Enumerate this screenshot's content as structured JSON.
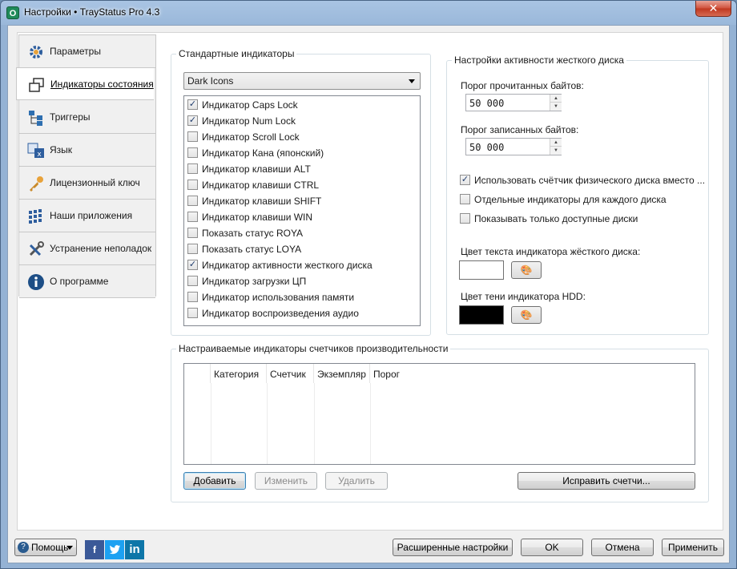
{
  "window": {
    "title": "Настройки • TrayStatus Pro 4.3",
    "app_icon_glyph": "O",
    "close_glyph": "✕"
  },
  "sidebar": {
    "items": [
      {
        "label": "Параметры",
        "icon": "gear-icon"
      },
      {
        "label": "Индикаторы состояния",
        "icon": "windows-icon",
        "active": true
      },
      {
        "label": "Триггеры",
        "icon": "tree-icon"
      },
      {
        "label": "Язык",
        "icon": "language-icon"
      },
      {
        "label": "Лицензионный ключ",
        "icon": "key-icon"
      },
      {
        "label": "Наши приложения",
        "icon": "apps-icon"
      },
      {
        "label": "Устранение неполадок",
        "icon": "tools-icon"
      },
      {
        "label": "О программе",
        "icon": "info-icon"
      }
    ]
  },
  "standard": {
    "title": "Стандартные индикаторы",
    "select_value": "Dark Icons",
    "items": [
      {
        "label": "Индикатор Caps Lock",
        "checked": true
      },
      {
        "label": "Индикатор Num Lock",
        "checked": true
      },
      {
        "label": "Индикатор Scroll Lock",
        "checked": false
      },
      {
        "label": "Индикатор Кана (японский)",
        "checked": false
      },
      {
        "label": "Индикатор клавиши ALT",
        "checked": false
      },
      {
        "label": "Индикатор клавиши CTRL",
        "checked": false
      },
      {
        "label": "Индикатор клавиши SHIFT",
        "checked": false
      },
      {
        "label": "Индикатор клавиши WIN",
        "checked": false
      },
      {
        "label": "Показать статус ROYA",
        "checked": false
      },
      {
        "label": "Показать статус LOYA",
        "checked": false
      },
      {
        "label": "Индикатор активности жесткого диска",
        "checked": true
      },
      {
        "label": "Индикатор загрузки ЦП",
        "checked": false
      },
      {
        "label": "Индикатор использования памяти",
        "checked": false
      },
      {
        "label": "Индикатор воспроизведения аудио",
        "checked": false
      }
    ]
  },
  "hdd": {
    "title": "Настройки активности жесткого диска",
    "read_label": "Порог прочитанных байтов:",
    "read_value": "50 000",
    "write_label": "Порог записанных байтов:",
    "write_value": "50 000",
    "options": [
      {
        "label": "Использовать счётчик физического диска вместо ...",
        "checked": true
      },
      {
        "label": "Отдельные индикаторы для каждого диска",
        "checked": false
      },
      {
        "label": "Показывать только доступные диски",
        "checked": false
      }
    ],
    "text_color_label": "Цвет текста индикатора жёсткого диска:",
    "text_color": "#ffffff",
    "shadow_color_label": "Цвет тени индикатора HDD:",
    "shadow_color": "#000000"
  },
  "perf": {
    "title": "Настраиваемые индикаторы счетчиков производительности",
    "columns": [
      "Категория",
      "Счетчик",
      "Экземпляр",
      "Порог"
    ],
    "add_label": "Добавить",
    "edit_label": "Изменить",
    "delete_label": "Удалить",
    "fix_label": "Исправить счетчи..."
  },
  "footer": {
    "help_label": "Помощь",
    "advanced_label": "Расширенные настройки",
    "ok_label": "OK",
    "cancel_label": "Отмена",
    "apply_label": "Применить",
    "facebook_glyph": "f",
    "linkedin_glyph": "in"
  },
  "colors": {
    "facebook": "#3b5998",
    "twitter": "#1da1f2",
    "linkedin": "#0e76a8",
    "check": "#1d3a6b"
  }
}
